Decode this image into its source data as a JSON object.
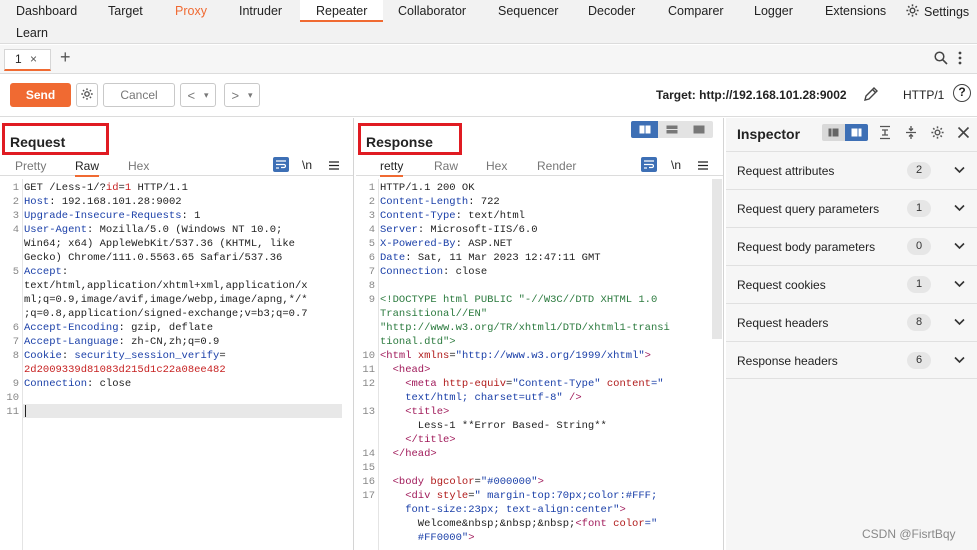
{
  "menu": {
    "tabs": [
      {
        "label": "Dashboard"
      },
      {
        "label": "Target"
      },
      {
        "label": "Proxy"
      },
      {
        "label": "Intruder"
      },
      {
        "label": "Repeater"
      },
      {
        "label": "Collaborator"
      },
      {
        "label": "Sequencer"
      },
      {
        "label": "Decoder"
      },
      {
        "label": "Comparer"
      },
      {
        "label": "Logger"
      },
      {
        "label": "Extensions"
      },
      {
        "label": "Learn"
      }
    ],
    "settings_label": "Settings",
    "accent": "#f06a32"
  },
  "tabstrip": {
    "tab_label": "1",
    "close_glyph": "×",
    "add_glyph": "+"
  },
  "toolbar": {
    "send_label": "Send",
    "cancel_label": "Cancel",
    "back_glyph": "<",
    "forward_glyph": ">",
    "dropdown_glyph": "▾",
    "target_text": "Target: http://192.168.101.28:9002",
    "http_version": "HTTP/1",
    "help_glyph": "?"
  },
  "request": {
    "title": "Request",
    "tabs": [
      "Pretty",
      "Raw",
      "Hex"
    ],
    "active_tab": "Raw",
    "newline_label": "\\n",
    "lines": [
      {
        "n": "1",
        "parts": [
          {
            "t": "GET /Less-1/?",
            "c": "val"
          },
          {
            "t": "id",
            "c": "red"
          },
          {
            "t": "=",
            "c": "val"
          },
          {
            "t": "1",
            "c": "red"
          },
          {
            "t": " HTTP/1.1",
            "c": "val"
          }
        ]
      },
      {
        "n": "2",
        "parts": [
          {
            "t": "Host",
            "c": "key"
          },
          {
            "t": ": 192.168.101.28:9002",
            "c": "val"
          }
        ]
      },
      {
        "n": "3",
        "parts": [
          {
            "t": "Upgrade-Insecure-Requests",
            "c": "key"
          },
          {
            "t": ": 1",
            "c": "val"
          }
        ]
      },
      {
        "n": "4",
        "parts": [
          {
            "t": "User-Agent",
            "c": "key"
          },
          {
            "t": ": Mozilla/5.0 (Windows NT 10.0;",
            "c": "val"
          }
        ]
      },
      {
        "n": "",
        "parts": [
          {
            "t": "Win64; x64) AppleWebKit/537.36 (KHTML, like",
            "c": "val"
          }
        ]
      },
      {
        "n": "",
        "parts": [
          {
            "t": "Gecko) Chrome/111.0.5563.65 Safari/537.36",
            "c": "val"
          }
        ]
      },
      {
        "n": "5",
        "parts": [
          {
            "t": "Accept",
            "c": "key"
          },
          {
            "t": ":",
            "c": "val"
          }
        ]
      },
      {
        "n": "",
        "parts": [
          {
            "t": "text/html,application/xhtml+xml,application/x",
            "c": "val"
          }
        ]
      },
      {
        "n": "",
        "parts": [
          {
            "t": "ml;q=0.9,image/avif,image/webp,image/apng,*/*",
            "c": "val"
          }
        ]
      },
      {
        "n": "",
        "parts": [
          {
            "t": ";q=0.8,application/signed-exchange;v=b3;q=0.7",
            "c": "val"
          }
        ]
      },
      {
        "n": "6",
        "parts": [
          {
            "t": "Accept-Encoding",
            "c": "key"
          },
          {
            "t": ": gzip, deflate",
            "c": "val"
          }
        ]
      },
      {
        "n": "7",
        "parts": [
          {
            "t": "Accept-Language",
            "c": "key"
          },
          {
            "t": ": zh-CN,zh;q=0.9",
            "c": "val"
          }
        ]
      },
      {
        "n": "8",
        "parts": [
          {
            "t": "Cookie",
            "c": "key"
          },
          {
            "t": ": ",
            "c": "val"
          },
          {
            "t": "security_session_verify",
            "c": "key"
          },
          {
            "t": "=",
            "c": "val"
          }
        ]
      },
      {
        "n": "",
        "parts": [
          {
            "t": "2d2009339d81083d215d1c22a08ee482",
            "c": "red"
          }
        ]
      },
      {
        "n": "9",
        "parts": [
          {
            "t": "Connection",
            "c": "key"
          },
          {
            "t": ": close",
            "c": "val"
          }
        ]
      },
      {
        "n": "10",
        "parts": []
      },
      {
        "n": "11",
        "parts": []
      }
    ]
  },
  "response": {
    "title": "Response",
    "tabs": [
      "retty",
      "Raw",
      "Hex",
      "Render"
    ],
    "active_tab": "retty",
    "newline_label": "\\n",
    "lines": [
      {
        "n": "1",
        "parts": [
          {
            "t": "HTTP/1.1 200 OK",
            "c": "val"
          }
        ]
      },
      {
        "n": "2",
        "parts": [
          {
            "t": "Content-Length",
            "c": "key"
          },
          {
            "t": ": 722",
            "c": "val"
          }
        ]
      },
      {
        "n": "3",
        "parts": [
          {
            "t": "Content-Type",
            "c": "key"
          },
          {
            "t": ": text/html",
            "c": "val"
          }
        ]
      },
      {
        "n": "4",
        "parts": [
          {
            "t": "Server",
            "c": "key"
          },
          {
            "t": ": Microsoft-IIS/6.0",
            "c": "val"
          }
        ]
      },
      {
        "n": "5",
        "parts": [
          {
            "t": "X-Powered-By",
            "c": "key"
          },
          {
            "t": ": ASP.NET",
            "c": "val"
          }
        ]
      },
      {
        "n": "6",
        "parts": [
          {
            "t": "Date",
            "c": "key"
          },
          {
            "t": ": Sat, 11 Mar 2023 12:47:11 GMT",
            "c": "val"
          }
        ]
      },
      {
        "n": "7",
        "parts": [
          {
            "t": "Connection",
            "c": "key"
          },
          {
            "t": ": close",
            "c": "val"
          }
        ]
      },
      {
        "n": "8",
        "parts": []
      },
      {
        "n": "9",
        "parts": [
          {
            "t": "<!DOCTYPE html PUBLIC \"-//W3C//DTD XHTML 1.0",
            "c": "green"
          }
        ]
      },
      {
        "n": "",
        "parts": [
          {
            "t": "Transitional//EN\"",
            "c": "green"
          }
        ]
      },
      {
        "n": "",
        "parts": [
          {
            "t": "\"http://www.w3.org/TR/xhtml1/DTD/xhtml1-transi",
            "c": "green"
          }
        ]
      },
      {
        "n": "",
        "parts": [
          {
            "t": "tional.dtd\">",
            "c": "green"
          }
        ]
      },
      {
        "n": "10",
        "parts": [
          {
            "t": "<html ",
            "c": "tag"
          },
          {
            "t": "xmlns",
            "c": "attr"
          },
          {
            "t": "=",
            "c": "val"
          },
          {
            "t": "\"http://www.w3.org/1999/xhtml\"",
            "c": "str"
          },
          {
            "t": ">",
            "c": "tag"
          }
        ]
      },
      {
        "n": "11",
        "parts": [
          {
            "t": "  <head>",
            "c": "tag"
          }
        ]
      },
      {
        "n": "12",
        "parts": [
          {
            "t": "    <meta ",
            "c": "tag"
          },
          {
            "t": "http-equiv",
            "c": "attr"
          },
          {
            "t": "=",
            "c": "val"
          },
          {
            "t": "\"Content-Type\"",
            "c": "str"
          },
          {
            "t": " content",
            "c": "attr"
          },
          {
            "t": "=\"",
            "c": "str"
          }
        ]
      },
      {
        "n": "",
        "parts": [
          {
            "t": "    text/html; charset=utf-8\"",
            "c": "str"
          },
          {
            "t": " />",
            "c": "tag"
          }
        ]
      },
      {
        "n": "13",
        "parts": [
          {
            "t": "    <title>",
            "c": "tag"
          }
        ]
      },
      {
        "n": "",
        "parts": [
          {
            "t": "      Less-1 **Error Based- String**",
            "c": "val"
          }
        ]
      },
      {
        "n": "",
        "parts": [
          {
            "t": "    </title>",
            "c": "tag"
          }
        ]
      },
      {
        "n": "14",
        "parts": [
          {
            "t": "  </head>",
            "c": "tag"
          }
        ]
      },
      {
        "n": "15",
        "parts": []
      },
      {
        "n": "16",
        "parts": [
          {
            "t": "  <body ",
            "c": "tag"
          },
          {
            "t": "bgcolor",
            "c": "attr"
          },
          {
            "t": "=",
            "c": "val"
          },
          {
            "t": "\"#000000\"",
            "c": "str"
          },
          {
            "t": ">",
            "c": "tag"
          }
        ]
      },
      {
        "n": "17",
        "parts": [
          {
            "t": "    <div ",
            "c": "tag"
          },
          {
            "t": "style",
            "c": "attr"
          },
          {
            "t": "=",
            "c": "val"
          },
          {
            "t": "\" margin-top:70px;color:#FFF;",
            "c": "str"
          }
        ]
      },
      {
        "n": "",
        "parts": [
          {
            "t": "    font-size:23px; text-align:center\"",
            "c": "str"
          },
          {
            "t": ">",
            "c": "tag"
          }
        ]
      },
      {
        "n": "",
        "parts": [
          {
            "t": "      Welcome&nbsp;&nbsp;&nbsp;",
            "c": "val"
          },
          {
            "t": "<font ",
            "c": "tag"
          },
          {
            "t": "color",
            "c": "attr"
          },
          {
            "t": "=\"",
            "c": "str"
          }
        ]
      },
      {
        "n": "",
        "parts": [
          {
            "t": "      #FF0000\"",
            "c": "str"
          },
          {
            "t": ">",
            "c": "tag"
          }
        ]
      }
    ]
  },
  "inspector": {
    "title": "Inspector",
    "rows": [
      {
        "label": "Request attributes",
        "count": "2"
      },
      {
        "label": "Request query parameters",
        "count": "1"
      },
      {
        "label": "Request body parameters",
        "count": "0"
      },
      {
        "label": "Request cookies",
        "count": "1"
      },
      {
        "label": "Request headers",
        "count": "8"
      },
      {
        "label": "Response headers",
        "count": "6"
      }
    ]
  },
  "watermark": "CSDN @FisrtBqy"
}
